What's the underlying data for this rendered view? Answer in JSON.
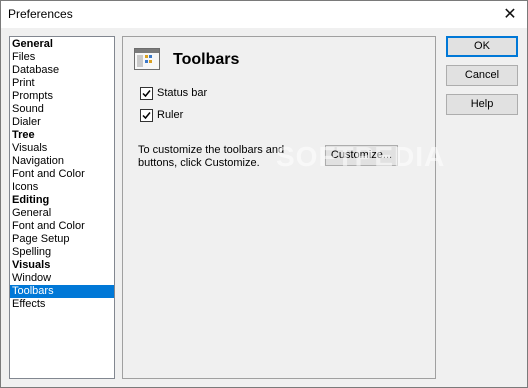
{
  "window": {
    "title": "Preferences"
  },
  "nav": {
    "items": [
      {
        "label": "General",
        "header": true
      },
      {
        "label": "Files"
      },
      {
        "label": "Database"
      },
      {
        "label": "Print"
      },
      {
        "label": "Prompts"
      },
      {
        "label": "Sound"
      },
      {
        "label": "Dialer"
      },
      {
        "label": "Tree",
        "header": true
      },
      {
        "label": "Visuals"
      },
      {
        "label": "Navigation"
      },
      {
        "label": "Font and Color"
      },
      {
        "label": "Icons"
      },
      {
        "label": "Editing",
        "header": true
      },
      {
        "label": "General"
      },
      {
        "label": "Font and Color"
      },
      {
        "label": "Page Setup"
      },
      {
        "label": "Spelling"
      },
      {
        "label": "Visuals",
        "header": true
      },
      {
        "label": "Window"
      },
      {
        "label": "Toolbars",
        "selected": true
      },
      {
        "label": "Effects"
      }
    ]
  },
  "panel": {
    "title": "Toolbars",
    "status_bar_label": "Status bar",
    "status_bar_checked": true,
    "ruler_label": "Ruler",
    "ruler_checked": true,
    "description": "To customize the toolbars and buttons, click Customize.",
    "customize_label": "Customize..."
  },
  "buttons": {
    "ok": "OK",
    "cancel": "Cancel",
    "help": "Help"
  },
  "watermark": "SOFTPEDIA",
  "colors": {
    "selection": "#0078d7",
    "default_button_border": "#0078d7"
  }
}
